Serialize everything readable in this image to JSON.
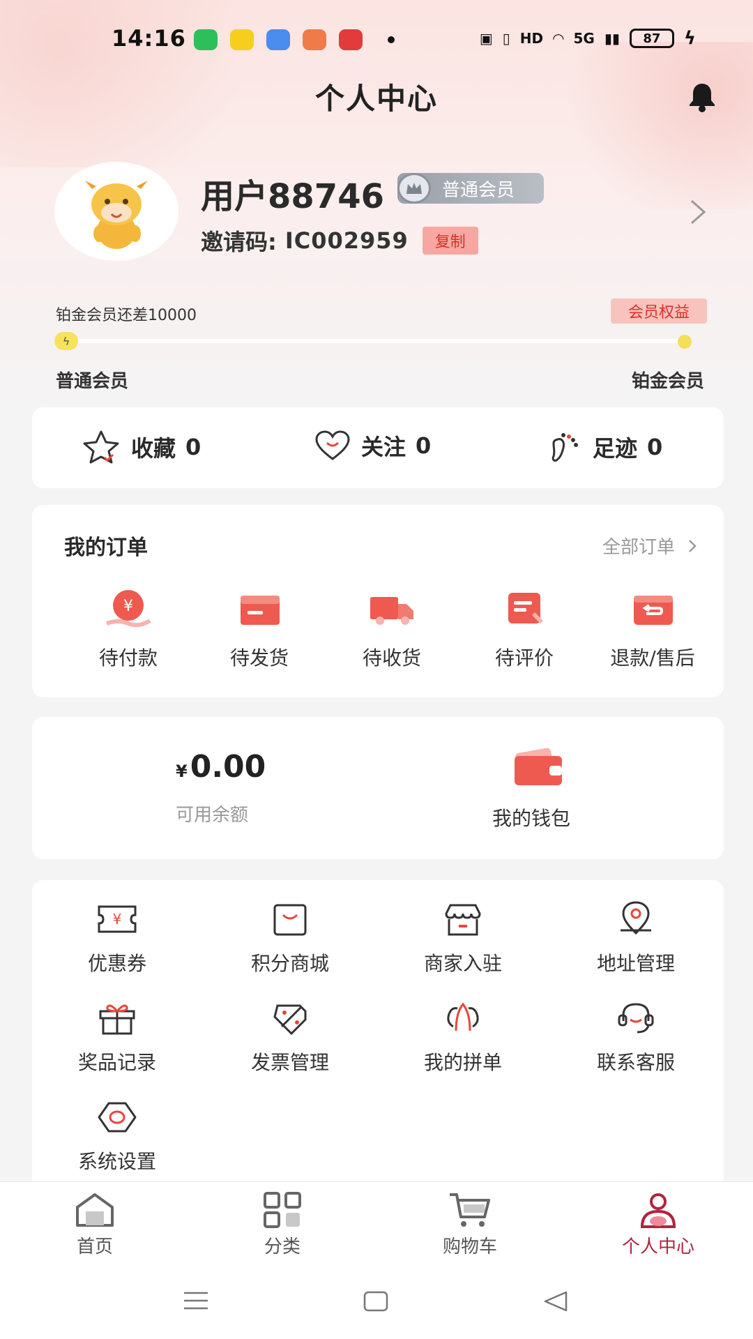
{
  "status_bar": {
    "time": "14:16",
    "battery": "87",
    "network": "5G",
    "hd": "HD",
    "app_colors": [
      "#2fbf5a",
      "#f6cf1d",
      "#4a8cf0",
      "#ef7b4a",
      "#e23b3b"
    ]
  },
  "header": {
    "title": "个人中心",
    "bell_icon": "bell-icon"
  },
  "profile": {
    "username": "用户88746",
    "member_level": "普通会员",
    "invite_label": "邀请码:",
    "invite_code": "IC002959",
    "copy_label": "复制"
  },
  "progress": {
    "text": "铂金会员还差10000",
    "rights_label": "会员权益",
    "current_level": "普通会员",
    "next_level": "铂金会员",
    "fraction": 0.0
  },
  "stats": [
    {
      "label": "收藏",
      "count": "0",
      "icon": "star-icon"
    },
    {
      "label": "关注",
      "count": "0",
      "icon": "heart-icon"
    },
    {
      "label": "足迹",
      "count": "0",
      "icon": "footprint-icon"
    }
  ],
  "orders": {
    "title": "我的订单",
    "all_label": "全部订单",
    "items": [
      {
        "label": "待付款",
        "icon": "pay-icon"
      },
      {
        "label": "待发货",
        "icon": "box-icon"
      },
      {
        "label": "待收货",
        "icon": "truck-icon"
      },
      {
        "label": "待评价",
        "icon": "review-icon"
      },
      {
        "label": "退款/售后",
        "icon": "refund-icon"
      }
    ]
  },
  "wallet": {
    "currency": "¥",
    "balance": "0.00",
    "balance_label": "可用余额",
    "wallet_label": "我的钱包"
  },
  "tools": [
    {
      "label": "优惠券",
      "icon": "coupon-icon"
    },
    {
      "label": "积分商城",
      "icon": "shopping-bag-icon"
    },
    {
      "label": "商家入驻",
      "icon": "store-icon"
    },
    {
      "label": "地址管理",
      "icon": "location-icon"
    },
    {
      "label": "奖品记录",
      "icon": "gift-icon"
    },
    {
      "label": "发票管理",
      "icon": "invoice-icon"
    },
    {
      "label": "我的拼单",
      "icon": "group-buy-icon"
    },
    {
      "label": "联系客服",
      "icon": "headset-icon"
    },
    {
      "label": "系统设置",
      "icon": "settings-icon"
    }
  ],
  "tabs": [
    {
      "label": "首页",
      "icon": "home-icon"
    },
    {
      "label": "分类",
      "icon": "grid-icon"
    },
    {
      "label": "购物车",
      "icon": "cart-icon"
    },
    {
      "label": "个人中心",
      "icon": "user-icon",
      "active": true
    }
  ],
  "colors": {
    "accent": "#e8453c",
    "active_tab": "#b0243c",
    "badge_bg": "#f8c2bd"
  }
}
